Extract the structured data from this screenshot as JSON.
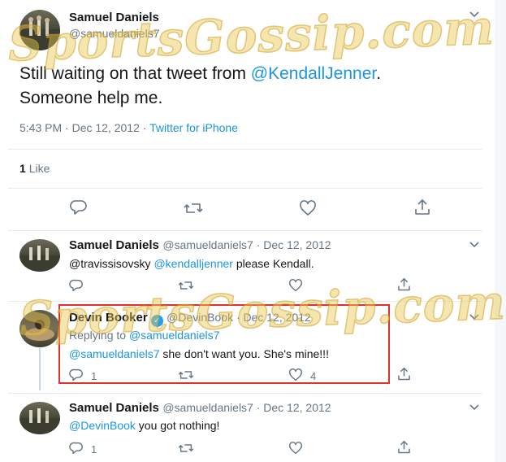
{
  "main_tweet": {
    "name": "Samuel Daniels",
    "handle": "@samueldaniels7",
    "text_before": "Still waiting on that tweet from ",
    "mention": "@KendallJenner",
    "text_after": ".",
    "text_line2": "Someone help me.",
    "time": "5:43 PM · Dec 12, 2012 · ",
    "source": "Twitter for iPhone",
    "like_count": "1",
    "like_label": "Like"
  },
  "replies": [
    {
      "name": "Samuel Daniels",
      "handle": "@samueldaniels7",
      "date": " · Dec 12, 2012",
      "text_prefix": "@travissisovsky ",
      "mention": "@kendalljenner",
      "text_suffix": " please Kendall."
    },
    {
      "name": "Devin Booker",
      "handle": "@DevinBook",
      "date": " · Dec 12, 2012",
      "replying_prefix": "Replying to ",
      "replying_handle": "@samueldaniels7",
      "mention": "@samueldaniels7",
      "text_suffix": " she don't want you. She's mine!!!",
      "reply_count": "1",
      "like_count": "4"
    },
    {
      "name": "Samuel Daniels",
      "handle": "@samueldaniels7",
      "date": " · Dec 12, 2012",
      "mention": "@DevinBook",
      "text_suffix": " you got nothing!",
      "reply_count": "1"
    }
  ],
  "watermark": {
    "text": "SportsGossip.com"
  },
  "colors": {
    "link": "#1b95e0",
    "muted": "#657786",
    "highlight_border": "#e0322b",
    "verified": "#1da1f2"
  },
  "icons": [
    "reply-icon",
    "retweet-icon",
    "like-icon",
    "share-icon",
    "chevron-down-icon",
    "verified-icon"
  ]
}
